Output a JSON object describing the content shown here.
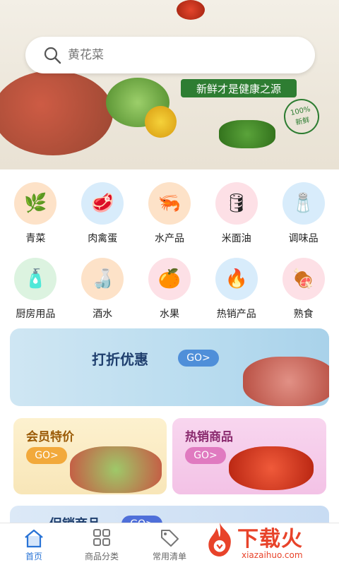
{
  "banner": {
    "search_placeholder": "黄花菜",
    "slogan": "新鲜才是健康之源",
    "stamp_line1": "100%",
    "stamp_line2": "新鲜"
  },
  "categories": [
    {
      "label": "青菜",
      "icon": "leaf-icon",
      "bg": "#fde2c8",
      "glyph": "🌿"
    },
    {
      "label": "肉禽蛋",
      "icon": "meat-icon",
      "bg": "#d8ecfb",
      "glyph": "🥩"
    },
    {
      "label": "水产品",
      "icon": "shrimp-icon",
      "bg": "#fde2c8",
      "glyph": "🦐"
    },
    {
      "label": "米面油",
      "icon": "oil-bottle-icon",
      "bg": "#fde0e6",
      "glyph": "🛢"
    },
    {
      "label": "调味品",
      "icon": "seasoning-icon",
      "bg": "#d8ecfb",
      "glyph": "🧂"
    },
    {
      "label": "厨房用品",
      "icon": "detergent-icon",
      "bg": "#dcf3e0",
      "glyph": "🧴"
    },
    {
      "label": "酒水",
      "icon": "liquor-icon",
      "bg": "#fde2c8",
      "glyph": "🍶"
    },
    {
      "label": "水果",
      "icon": "orange-icon",
      "bg": "#fde0e6",
      "glyph": "🍊"
    },
    {
      "label": "热销产品",
      "icon": "hot-sale-icon",
      "bg": "#d8ecfb",
      "glyph": "🔥"
    },
    {
      "label": "熟食",
      "icon": "cooked-meat-icon",
      "bg": "#fde0e6",
      "glyph": "🍖"
    }
  ],
  "discount": {
    "title": "打折优惠",
    "go": "GO>"
  },
  "member": {
    "title": "会员特价",
    "go": "GO>"
  },
  "hot": {
    "title": "热销商品",
    "go": "GO>"
  },
  "sale": {
    "title": "促销商品",
    "go": "GO>"
  },
  "tabs": [
    {
      "label": "首页",
      "icon": "home-icon",
      "active": true
    },
    {
      "label": "商品分类",
      "icon": "grid-icon",
      "active": false
    },
    {
      "label": "常用清单",
      "icon": "tag-icon",
      "active": false
    }
  ],
  "watermark": {
    "big": "下载火",
    "small": "xiazaihuo.com"
  },
  "colors": {
    "accent": "#2a74d6",
    "brand_green": "#2e7d32",
    "watermark": "#e8432a"
  }
}
